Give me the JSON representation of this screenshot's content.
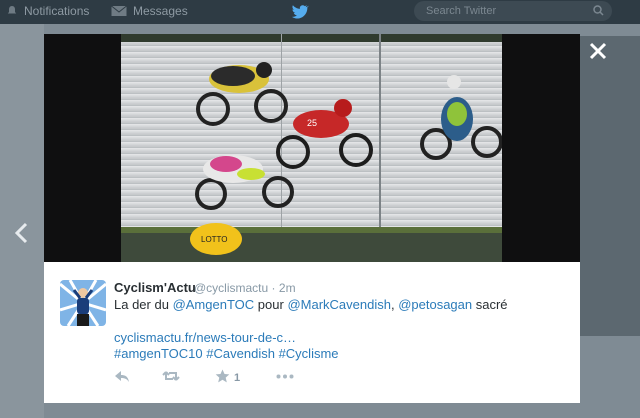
{
  "topbar": {
    "notifications_label": "Notifications",
    "messages_label": "Messages",
    "search_placeholder": "Search Twitter"
  },
  "tweet": {
    "author_name": "Cyclism'Actu",
    "handle": "@cyclismactu",
    "time_sep": "·",
    "time": "2m",
    "text_prefix": "La der du",
    "mention_1": "@AmgenTOC",
    "text_mid": "pour",
    "mention_2": "@MarkCavendish",
    "comma": ",",
    "mention_3": "@petosagan",
    "text_suffix": "sacré",
    "link": "cyclismactu.fr/news-tour-de-c…",
    "hashtags": [
      "#amgenTOC10",
      "#Cavendish",
      "#Cyclisme"
    ],
    "favorite_count": "1"
  },
  "icons": {
    "reply": "reply-icon",
    "retweet": "retweet-icon",
    "favorite": "star-icon",
    "more": "more-icon",
    "close": "close-icon",
    "prev": "chevron-left-icon"
  },
  "colors": {
    "link_blue": "#2b7bb9",
    "text": "#292f33",
    "muted": "#8899a6"
  }
}
